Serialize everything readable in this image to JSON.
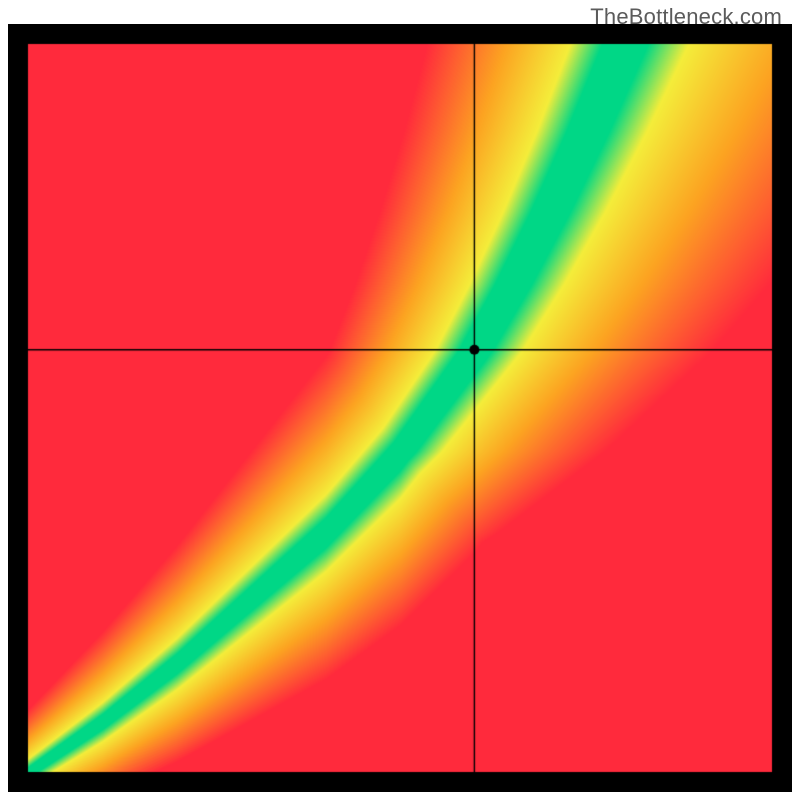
{
  "watermark": "TheBottleneck.com",
  "chart_data": {
    "type": "heatmap",
    "title": "",
    "xlabel": "",
    "ylabel": "",
    "x_range": [
      0,
      100
    ],
    "y_range": [
      0,
      100
    ],
    "crosshair": {
      "x": 60,
      "y": 58
    },
    "marker": {
      "x": 60,
      "y": 58,
      "radius": 5,
      "color": "#000000"
    },
    "optimal_curve_comment": "green ridge: y as function of x (approx, read from image)",
    "optimal_curve": [
      {
        "x": 0,
        "y": 0
      },
      {
        "x": 10,
        "y": 7
      },
      {
        "x": 20,
        "y": 15
      },
      {
        "x": 30,
        "y": 24
      },
      {
        "x": 40,
        "y": 33
      },
      {
        "x": 50,
        "y": 44
      },
      {
        "x": 55,
        "y": 51
      },
      {
        "x": 60,
        "y": 58
      },
      {
        "x": 65,
        "y": 67
      },
      {
        "x": 70,
        "y": 77
      },
      {
        "x": 75,
        "y": 88
      },
      {
        "x": 80,
        "y": 100
      }
    ],
    "colors": {
      "background": "#000000",
      "crosshair": "#000000",
      "optimal": "#00d786",
      "near": "#f4ed3a",
      "mid": "#fca321",
      "far": "#ff2a3c"
    },
    "border_px": 20
  }
}
